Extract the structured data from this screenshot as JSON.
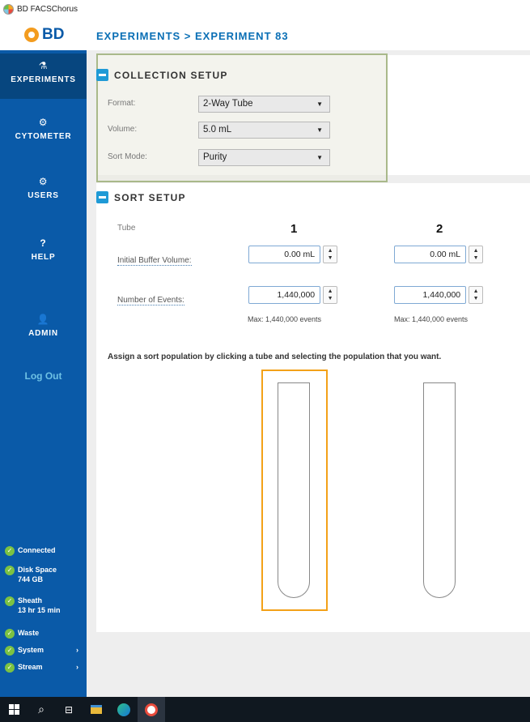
{
  "window": {
    "title": "BD FACSChorus"
  },
  "header": {
    "logo": "BD",
    "breadcrumb": "EXPERIMENTS > EXPERIMENT 83"
  },
  "sidebar": {
    "items": [
      {
        "label": "EXPERIMENTS",
        "icon": "flask-icon",
        "glyph": "⚗",
        "active": true
      },
      {
        "label": "CYTOMETER",
        "icon": "gear-icon",
        "glyph": "⚙"
      },
      {
        "label": "USERS",
        "icon": "gear-icon",
        "glyph": "⚙"
      },
      {
        "label": "HELP",
        "icon": "help-icon",
        "glyph": "?"
      },
      {
        "label": "ADMIN",
        "icon": "person-icon",
        "glyph": "👤"
      }
    ],
    "logout": "Log Out",
    "status": [
      {
        "label": "Connected",
        "sub": ""
      },
      {
        "label": "Disk Space",
        "sub": "744 GB"
      },
      {
        "label": "Sheath",
        "sub": "13 hr 15 min"
      },
      {
        "label": "Waste",
        "sub": ""
      },
      {
        "label": "System",
        "sub": ""
      },
      {
        "label": "Stream",
        "sub": ""
      }
    ],
    "status_color": "#7cc242"
  },
  "collection": {
    "title": "COLLECTION SETUP",
    "format_label": "Format:",
    "format_value": "2-Way Tube",
    "volume_label": "Volume:",
    "volume_value": "5.0 mL",
    "sortmode_label": "Sort Mode:",
    "sortmode_value": "Purity"
  },
  "sort": {
    "title": "SORT SETUP",
    "tube_label": "Tube",
    "tube1": "1",
    "tube2": "2",
    "buffer_label": "Initial Buffer Volume:",
    "buffer1": "0.00 mL",
    "buffer2": "0.00 mL",
    "events_label": "Number of Events:",
    "events1": "1,440,000",
    "events2": "1,440,000",
    "max1": "Max: 1,440,000 events",
    "max2": "Max: 1,440,000 events",
    "instruction": "Assign a sort population by clicking a tube and selecting the population that you want."
  },
  "colors": {
    "sidebar": "#0a5aa8",
    "accent": "#1f9ad6",
    "selected_tube": "#f3a118"
  }
}
